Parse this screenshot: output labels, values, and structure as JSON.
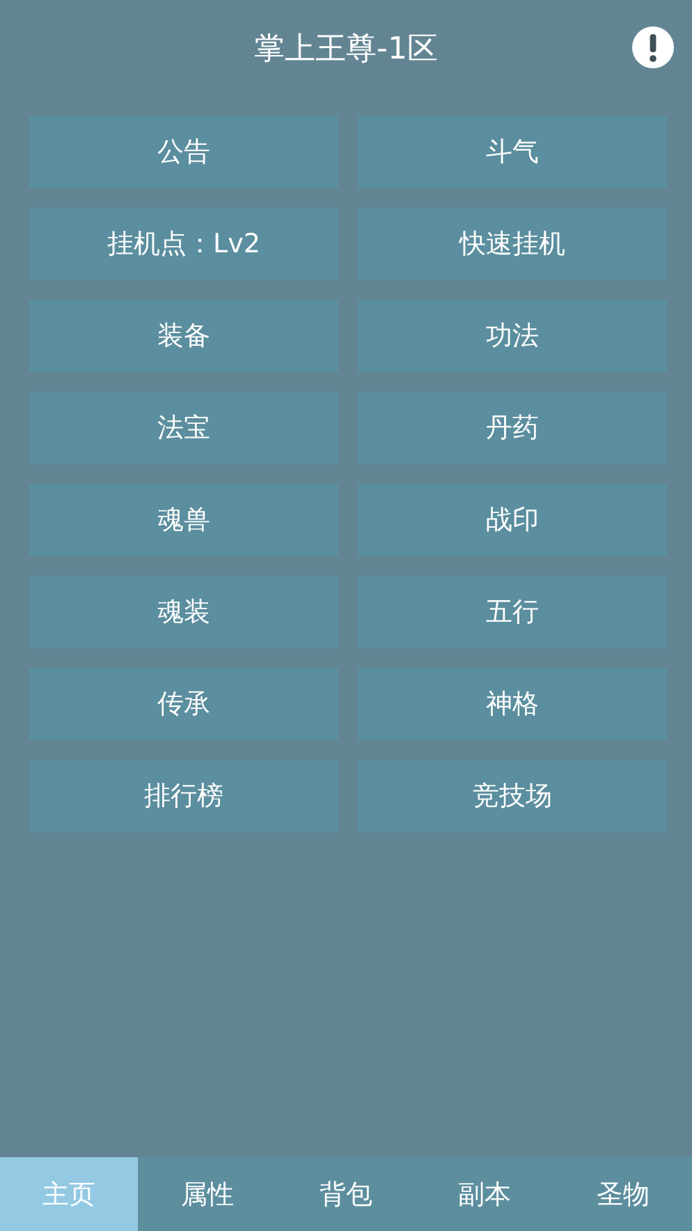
{
  "header": {
    "title": "掌上王尊-1区"
  },
  "menu_buttons": [
    "公告",
    "斗气",
    "挂机点：Lv2",
    "快速挂机",
    "装备",
    "功法",
    "法宝",
    "丹药",
    "魂兽",
    "战印",
    "魂装",
    "五行",
    "传承",
    "神格",
    "排行榜",
    "竞技场"
  ],
  "tab_bar": [
    {
      "label": "主页",
      "selected": true
    },
    {
      "label": "属性",
      "selected": false
    },
    {
      "label": "背包",
      "selected": false
    },
    {
      "label": "副本",
      "selected": false
    },
    {
      "label": "圣物",
      "selected": false
    }
  ]
}
